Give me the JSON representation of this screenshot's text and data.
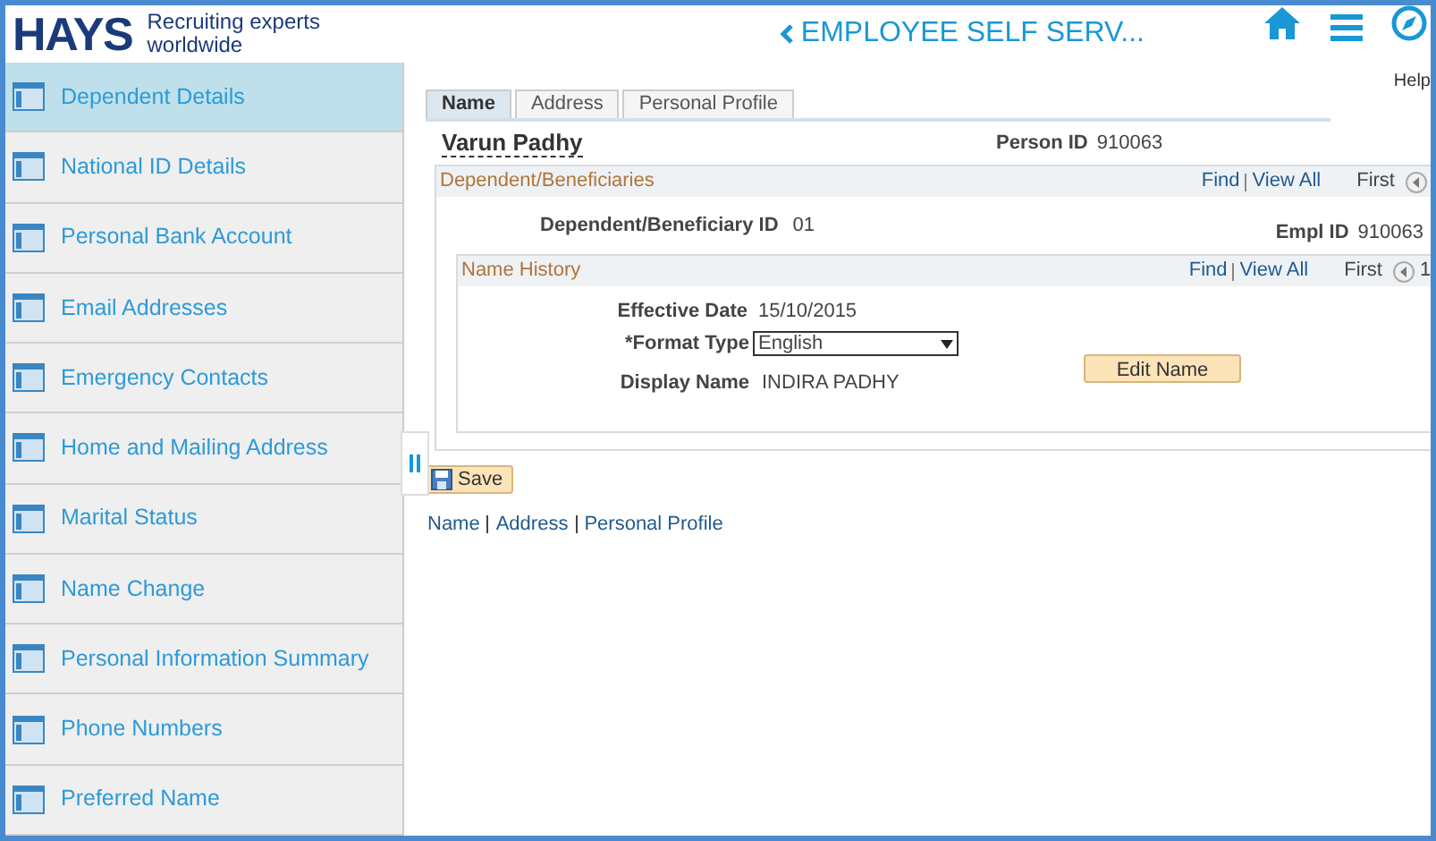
{
  "header": {
    "brand": "HAYS",
    "tagline_1": "Recruiting experts",
    "tagline_2": "worldwide",
    "title": "EMPLOYEE SELF SERV...",
    "help": "Help"
  },
  "sidebar": {
    "items": [
      {
        "label": "Dependent Details",
        "selected": true
      },
      {
        "label": "National ID Details",
        "selected": false
      },
      {
        "label": "Personal Bank Account",
        "selected": false
      },
      {
        "label": "Email Addresses",
        "selected": false
      },
      {
        "label": "Emergency Contacts",
        "selected": false
      },
      {
        "label": "Home and Mailing Address",
        "selected": false
      },
      {
        "label": "Marital Status",
        "selected": false
      },
      {
        "label": "Name Change",
        "selected": false
      },
      {
        "label": "Personal Information Summary",
        "selected": false
      },
      {
        "label": "Phone Numbers",
        "selected": false
      },
      {
        "label": "Preferred Name",
        "selected": false
      }
    ]
  },
  "tabs": [
    {
      "label": "Name",
      "selected": true
    },
    {
      "label": "Address",
      "selected": false
    },
    {
      "label": "Personal Profile",
      "selected": false
    }
  ],
  "person": {
    "name": "Varun Padhy",
    "id_label": "Person ID",
    "id_value": "910063"
  },
  "dependents": {
    "title": "Dependent/Beneficiaries",
    "find": "Find",
    "view_all": "View All",
    "first": "First",
    "dep_label": "Dependent/Beneficiary ID",
    "dep_value": "01",
    "empl_label": "Empl ID",
    "empl_value": "910063",
    "name_history": {
      "title": "Name History",
      "find": "Find",
      "view_all": "View All",
      "first": "First",
      "count": "1",
      "effective_label": "Effective Date",
      "effective_value": "15/10/2015",
      "format_label": "*Format Type",
      "format_value": "English",
      "display_label": "Display Name",
      "display_value": "INDIRA PADHY",
      "edit_button": "Edit Name"
    }
  },
  "save_button": "Save",
  "footer_links": [
    "Name",
    "Address",
    "Personal Profile"
  ]
}
